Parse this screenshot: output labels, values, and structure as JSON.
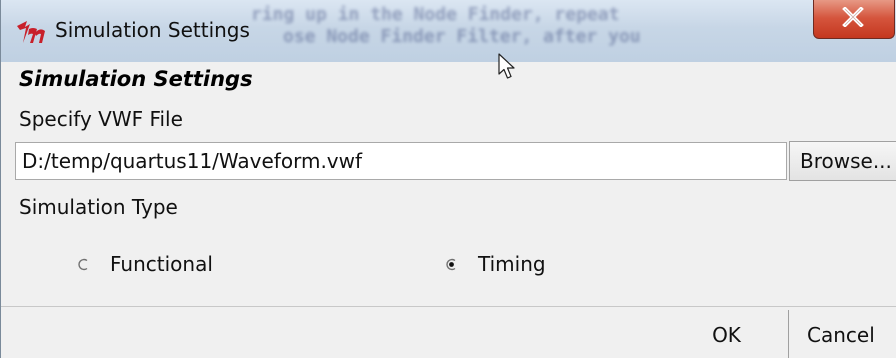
{
  "window": {
    "title": "Simulation Settings",
    "background_text": [
      "ring up in the Node Finder, repeat",
      "ose Node Finder Filter, after you"
    ],
    "icon": "tk-feather-icon",
    "close_icon": "close-icon"
  },
  "dialog": {
    "heading": "Simulation Settings",
    "vwf_label": "Specify VWF File",
    "vwf_path": "D:/temp/quartus11/Waveform.vwf",
    "browse_label": "Browse...",
    "sim_type_label": "Simulation Type",
    "options": [
      {
        "label": "Functional",
        "selected": false
      },
      {
        "label": "Timing",
        "selected": true
      }
    ],
    "ok_label": "OK",
    "cancel_label": "Cancel"
  },
  "colors": {
    "close_button": "#d5553d",
    "titlebar": "#c7d6e6",
    "app_icon_red": "#c8202a"
  }
}
